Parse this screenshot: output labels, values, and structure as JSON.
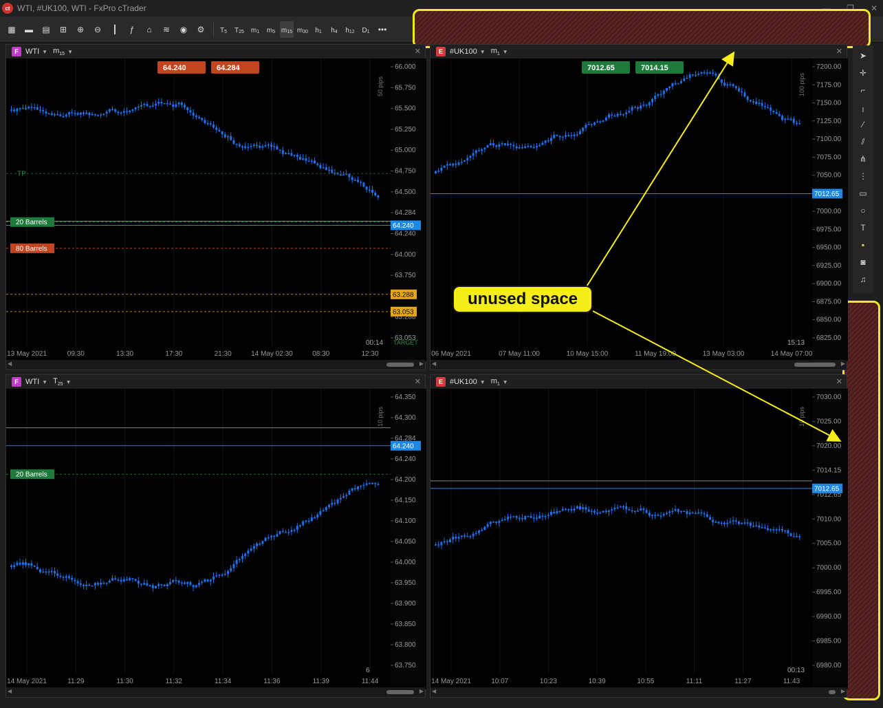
{
  "window": {
    "title": "WTI, #UK100, WTI - FxPro cTrader",
    "min": "—",
    "max": "❐",
    "close": "✕"
  },
  "toolbar": {
    "timeframes": [
      {
        "base": "T",
        "sub": "5"
      },
      {
        "base": "T",
        "sub": "25"
      },
      {
        "base": "m",
        "sub": "1"
      },
      {
        "base": "m",
        "sub": "5"
      },
      {
        "base": "m",
        "sub": "15"
      },
      {
        "base": "m",
        "sub": "30"
      },
      {
        "base": "h",
        "sub": "1"
      },
      {
        "base": "h",
        "sub": "4"
      },
      {
        "base": "h",
        "sub": "12"
      },
      {
        "base": "D",
        "sub": "1"
      }
    ],
    "more": "•••"
  },
  "annotation": {
    "label": "unused space",
    "color": "#f5ee1a"
  },
  "panels": [
    {
      "id": "wti-m15",
      "symbol": "WTI",
      "badge": "F",
      "tf_base": "m",
      "tf_sub": "15",
      "sell_price": "64.240",
      "buy_price": "64.284",
      "pips_scale": "50 pips",
      "price_ticks": [
        "66.000",
        "65.750",
        "65.500",
        "65.250",
        "65.000",
        "64.750",
        "64.500",
        "64.284",
        "64.240",
        "64.000",
        "63.750",
        "63.500",
        "63.288",
        "63.053"
      ],
      "time_ticks": [
        "13 May 2021",
        "09:30",
        "13:30",
        "17:30",
        "21:30",
        "14 May 02:30",
        "08:30",
        "12:30"
      ],
      "countdown": "00:14",
      "tp_label": "TP",
      "target_label": "TARGET",
      "order_buy": "20 Barrels",
      "order_sell": "80 Barrels",
      "bid": "64.240",
      "ask": "64.284",
      "level1": "63.288",
      "level2": "63.053"
    },
    {
      "id": "uk100-m1-top",
      "symbol": "#UK100",
      "badge": "E",
      "tf_base": "m",
      "tf_sub": "1",
      "sell_price": "7012.65",
      "buy_price": "7014.15",
      "pips_scale": "100 pips",
      "price_ticks": [
        "7200.00",
        "7175.00",
        "7150.00",
        "7125.00",
        "7100.00",
        "7075.00",
        "7050.00",
        "7025.00",
        "7000.00",
        "6975.00",
        "6950.00",
        "6925.00",
        "6900.00",
        "6875.00",
        "6850.00",
        "6825.00"
      ],
      "time_ticks": [
        "06 May 2021",
        "07 May 11:00",
        "10 May 15:00",
        "11 May 19:00",
        "13 May 03:00",
        "14 May 07:00"
      ],
      "countdown": "15:13",
      "bid": "7012.65"
    },
    {
      "id": "wti-t25",
      "symbol": "WTI",
      "badge": "F",
      "tf_base": "T",
      "tf_sub": "25",
      "pips_scale": "10 pips",
      "price_ticks": [
        "64.350",
        "64.300",
        "64.284",
        "64.240",
        "64.200",
        "64.150",
        "64.100",
        "64.050",
        "64.000",
        "63.950",
        "63.900",
        "63.850",
        "63.800",
        "63.750"
      ],
      "time_ticks": [
        "14 May 2021",
        "11:29",
        "11:30",
        "11:32",
        "11:34",
        "11:36",
        "11:39",
        "11:44"
      ],
      "countdown": "6",
      "order_buy": "20 Barrels",
      "bid": "64.240",
      "ask": "64.284"
    },
    {
      "id": "uk100-m1-bottom",
      "symbol": "#UK100",
      "badge": "E",
      "tf_base": "m",
      "tf_sub": "1",
      "pips_scale": "10 pips",
      "price_ticks": [
        "7030.00",
        "7025.00",
        "7020.00",
        "7014.15",
        "7012.65",
        "7010.00",
        "7005.00",
        "7000.00",
        "6995.00",
        "6990.00",
        "6985.00",
        "6980.00"
      ],
      "time_ticks": [
        "14 May 2021",
        "10:07",
        "10:23",
        "10:39",
        "10:55",
        "11:11",
        "11:27",
        "11:43"
      ],
      "countdown": "00:13",
      "bid": "7012.65",
      "ask": "7014.15"
    }
  ],
  "colors": {
    "candle": "#1f6fe8",
    "bid_line": "#1e88e5",
    "ask_line": "#888888",
    "sell": "#c2451f",
    "buy": "#1e7a3a",
    "level": "#e5a51a"
  }
}
